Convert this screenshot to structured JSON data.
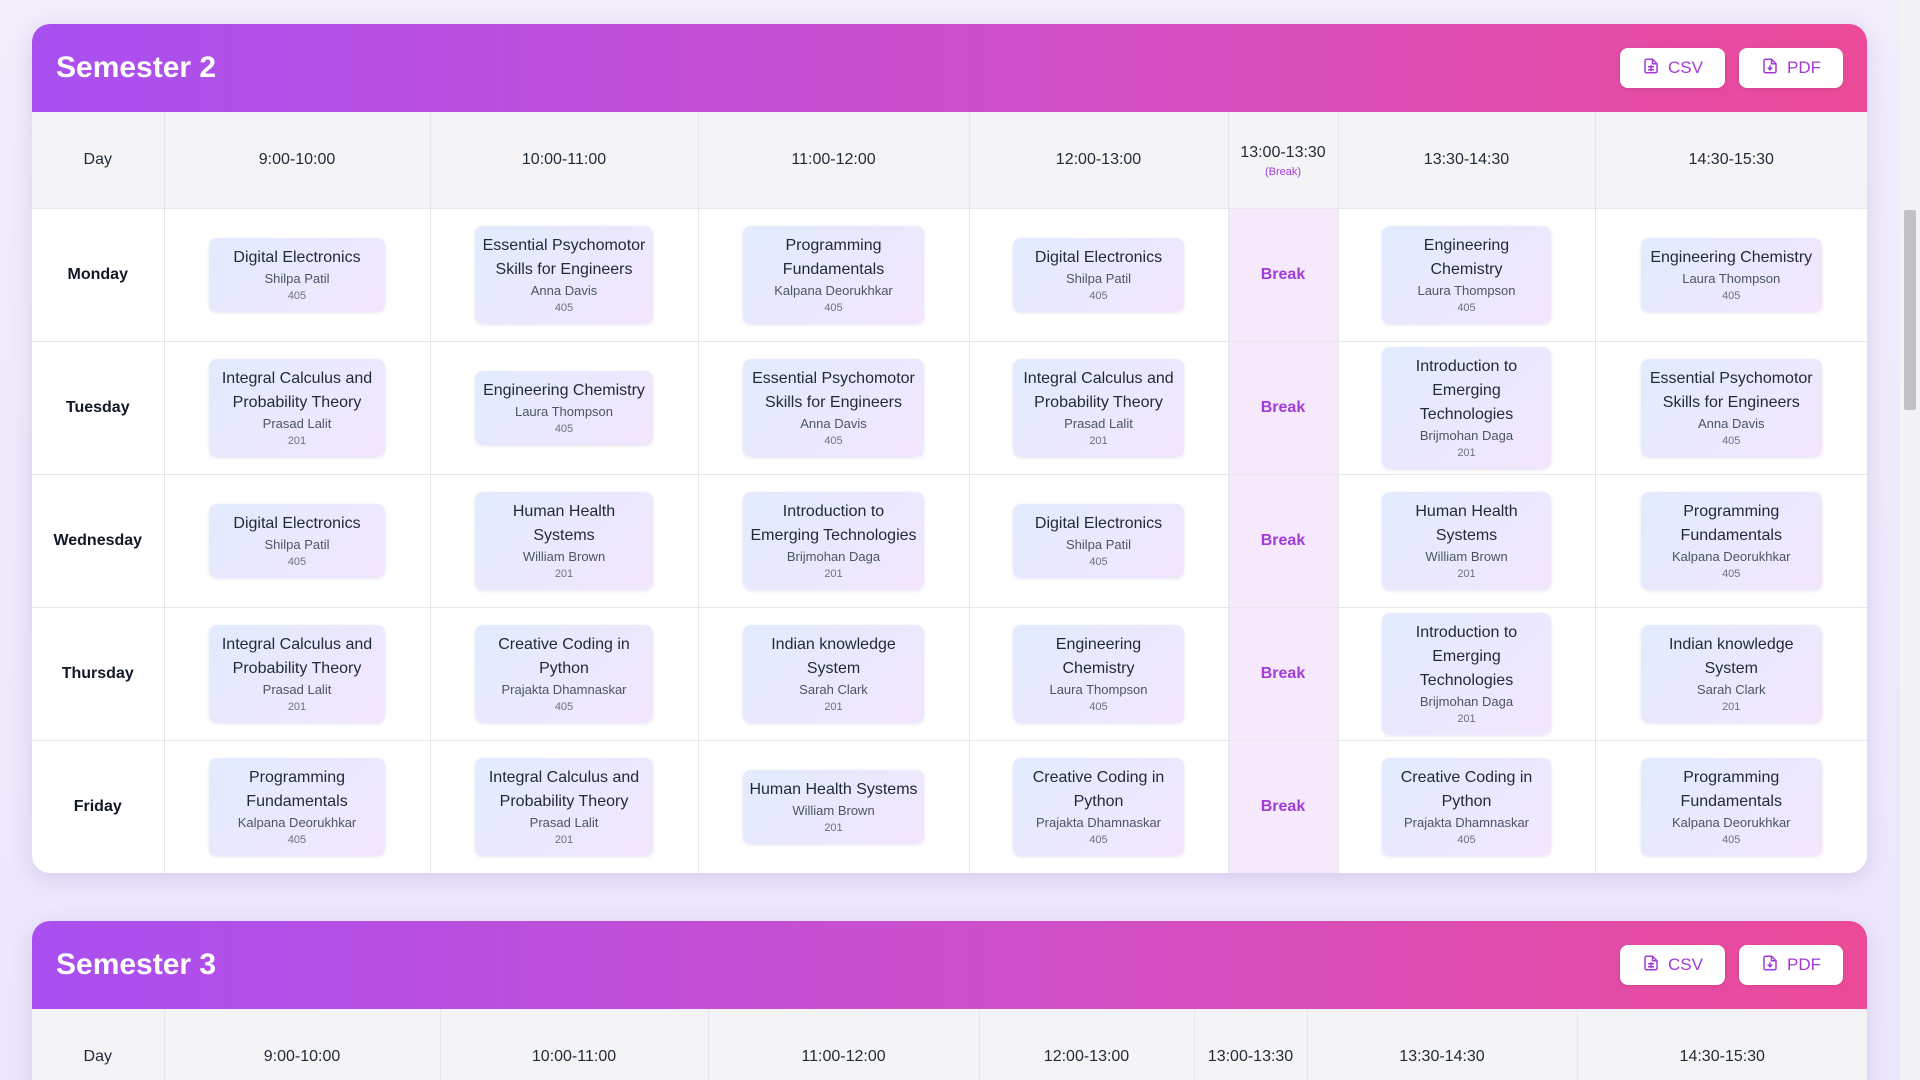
{
  "sem2": {
    "title": "Semester 2",
    "csv_label": "CSV",
    "pdf_label": "PDF",
    "headers": [
      "Day",
      "9:00-10:00",
      "10:00-11:00",
      "11:00-12:00",
      "12:00-13:00",
      "13:00-13:30",
      "13:30-14:30",
      "14:30-15:30"
    ],
    "break_sub": "(Break)",
    "break_label": "Break",
    "rows": [
      {
        "day": "Monday",
        "slots": [
          {
            "subject": "Digital Electronics",
            "teacher": "Shilpa Patil",
            "room": "405"
          },
          {
            "subject": "Essential Psychomotor Skills for Engineers",
            "teacher": "Anna Davis",
            "room": "405"
          },
          {
            "subject": "Programming Fundamentals",
            "teacher": "Kalpana Deorukhkar",
            "room": "405"
          },
          {
            "subject": "Digital Electronics",
            "teacher": "Shilpa Patil",
            "room": "405"
          },
          {
            "subject": "Engineering Chemistry",
            "teacher": "Laura Thompson",
            "room": "405"
          },
          {
            "subject": "Engineering Chemistry",
            "teacher": "Laura Thompson",
            "room": "405"
          }
        ]
      },
      {
        "day": "Tuesday",
        "slots": [
          {
            "subject": "Integral Calculus and Probability Theory",
            "teacher": "Prasad Lalit",
            "room": "201"
          },
          {
            "subject": "Engineering Chemistry",
            "teacher": "Laura Thompson",
            "room": "405"
          },
          {
            "subject": "Essential Psychomotor Skills for Engineers",
            "teacher": "Anna Davis",
            "room": "405"
          },
          {
            "subject": "Integral Calculus and Probability Theory",
            "teacher": "Prasad Lalit",
            "room": "201"
          },
          {
            "subject": "Introduction to Emerging Technologies",
            "teacher": "Brijmohan Daga",
            "room": "201"
          },
          {
            "subject": "Essential Psychomotor Skills for Engineers",
            "teacher": "Anna Davis",
            "room": "405"
          }
        ]
      },
      {
        "day": "Wednesday",
        "slots": [
          {
            "subject": "Digital Electronics",
            "teacher": "Shilpa Patil",
            "room": "405"
          },
          {
            "subject": "Human Health Systems",
            "teacher": "William Brown",
            "room": "201"
          },
          {
            "subject": "Introduction to Emerging Technologies",
            "teacher": "Brijmohan Daga",
            "room": "201"
          },
          {
            "subject": "Digital Electronics",
            "teacher": "Shilpa Patil",
            "room": "405"
          },
          {
            "subject": "Human Health Systems",
            "teacher": "William Brown",
            "room": "201"
          },
          {
            "subject": "Programming Fundamentals",
            "teacher": "Kalpana Deorukhkar",
            "room": "405"
          }
        ]
      },
      {
        "day": "Thursday",
        "slots": [
          {
            "subject": "Integral Calculus and Probability Theory",
            "teacher": "Prasad Lalit",
            "room": "201"
          },
          {
            "subject": "Creative Coding in Python",
            "teacher": "Prajakta Dhamnaskar",
            "room": "405"
          },
          {
            "subject": "Indian knowledge System",
            "teacher": "Sarah Clark",
            "room": "201"
          },
          {
            "subject": "Engineering Chemistry",
            "teacher": "Laura Thompson",
            "room": "405"
          },
          {
            "subject": "Introduction to Emerging Technologies",
            "teacher": "Brijmohan Daga",
            "room": "201"
          },
          {
            "subject": "Indian knowledge System",
            "teacher": "Sarah Clark",
            "room": "201"
          }
        ]
      },
      {
        "day": "Friday",
        "slots": [
          {
            "subject": "Programming Fundamentals",
            "teacher": "Kalpana Deorukhkar",
            "room": "405"
          },
          {
            "subject": "Integral Calculus and Probability Theory",
            "teacher": "Prasad Lalit",
            "room": "201"
          },
          {
            "subject": "Human Health Systems",
            "teacher": "William Brown",
            "room": "201"
          },
          {
            "subject": "Creative Coding in Python",
            "teacher": "Prajakta Dhamnaskar",
            "room": "405"
          },
          {
            "subject": "Creative Coding in Python",
            "teacher": "Prajakta Dhamnaskar",
            "room": "405"
          },
          {
            "subject": "Programming Fundamentals",
            "teacher": "Kalpana Deorukhkar",
            "room": "405"
          }
        ]
      }
    ]
  },
  "sem3": {
    "title": "Semester 3",
    "csv_label": "CSV",
    "pdf_label": "PDF",
    "headers": [
      "Day",
      "9:00-10:00",
      "10:00-11:00",
      "11:00-12:00",
      "12:00-13:00",
      "13:00-13:30",
      "13:30-14:30",
      "14:30-15:30"
    ]
  },
  "icons": {
    "csv": "file-spreadsheet-icon",
    "pdf": "file-download-icon"
  },
  "colors": {
    "header_start": "#a94ff0",
    "header_end": "#ec4a98",
    "accent": "#a23bd7",
    "break_bg": "#f5e9fb"
  }
}
